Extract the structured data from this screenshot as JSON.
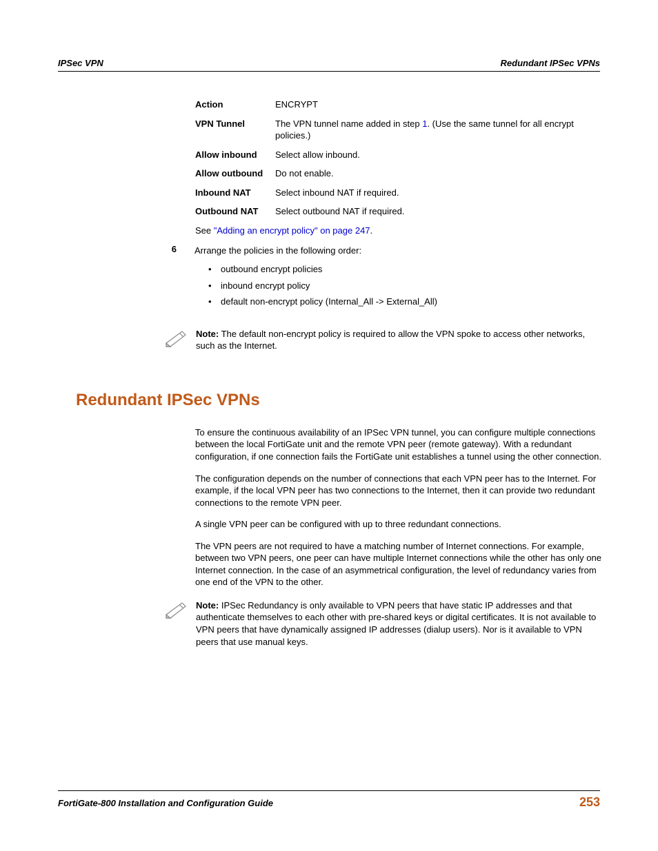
{
  "header": {
    "left": "IPSec VPN",
    "right": "Redundant IPSec VPNs"
  },
  "table": {
    "rows": [
      {
        "label": "Action",
        "value": "ENCRYPT"
      },
      {
        "label": "VPN Tunnel",
        "value_pre": "The VPN tunnel name added in step ",
        "step_link": "1",
        "value_post": ". (Use the same tunnel for all encrypt policies.)"
      },
      {
        "label": "Allow inbound",
        "value": "Select allow inbound."
      },
      {
        "label": "Allow outbound",
        "value": "Do not enable."
      },
      {
        "label": "Inbound NAT",
        "value": "Select inbound NAT if required."
      },
      {
        "label": "Outbound NAT",
        "value": "Select outbound NAT if required."
      }
    ]
  },
  "see_line": {
    "pre": "See ",
    "link": "\"Adding an encrypt policy\" on page 247",
    "post": "."
  },
  "step6": {
    "num": "6",
    "lead": "Arrange the policies in the following order:",
    "bullets": [
      "outbound encrypt policies",
      "inbound encrypt policy",
      "default non-encrypt policy (Internal_All -> External_All)"
    ]
  },
  "note1": {
    "bold": "Note:",
    "text": " The default non-encrypt policy is required to allow the VPN spoke to access other networks, such as the Internet."
  },
  "section_title": "Redundant IPSec VPNs",
  "section_paras": [
    "To ensure the continuous availability of an IPSec VPN tunnel, you can configure multiple connections between the local FortiGate unit and the remote VPN peer (remote gateway). With a redundant configuration, if one connection fails the FortiGate unit establishes a tunnel using the other connection.",
    "The configuration depends on the number of connections that each VPN peer has to the Internet. For example, if the local VPN peer has two connections to the Internet, then it can provide two redundant connections to the remote VPN peer.",
    "A single VPN peer can be configured with up to three redundant connections.",
    "The VPN peers are not required to have a matching number of Internet connections. For example, between two VPN peers, one peer can have multiple Internet connections while the other has only one Internet connection. In the case of an asymmetrical configuration, the level of redundancy varies from one end of the VPN to the other."
  ],
  "note2": {
    "bold": "Note:",
    "text": " IPSec Redundancy is only available to VPN peers that have static IP addresses and that authenticate themselves to each other with pre-shared keys or digital certificates. It is not available to VPN peers that have dynamically assigned IP addresses (dialup users). Nor is it available to VPN peers that use manual keys."
  },
  "footer": {
    "left": "FortiGate-800 Installation and Configuration Guide",
    "right": "253"
  }
}
